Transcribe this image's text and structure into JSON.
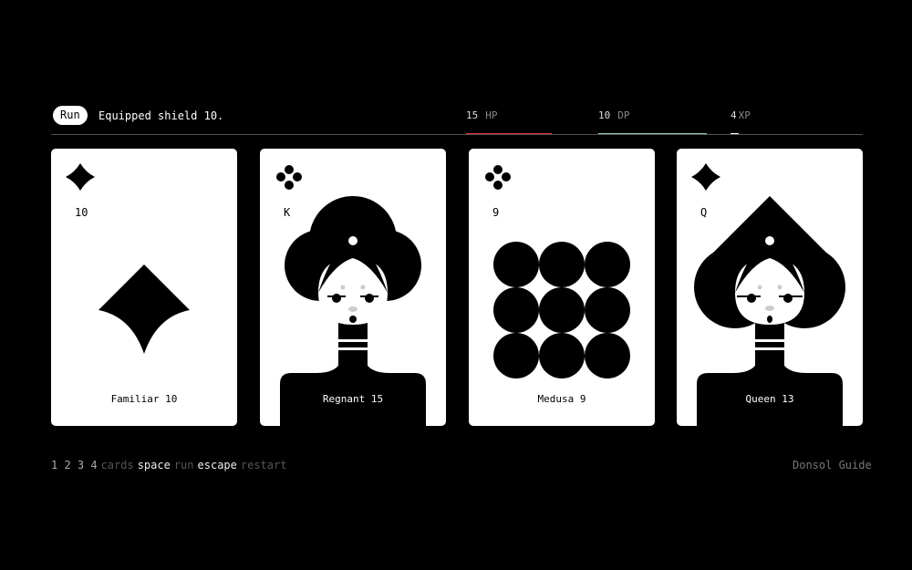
{
  "header": {
    "run_label": "Run",
    "message": "Equipped shield 10.",
    "stats": {
      "hp": {
        "value": "15",
        "label": "HP",
        "fraction": 0.65,
        "color": "#e3303a"
      },
      "dp": {
        "value": "10",
        "label": "DP",
        "fraction": 0.82,
        "color": "#8fd1b4"
      },
      "xp": {
        "value": "4",
        "label": "XP",
        "fraction": 0.06,
        "color": "#ffffff"
      }
    }
  },
  "cards": [
    {
      "suit": "diamond",
      "value": "10",
      "name": "Familiar 10",
      "art": "diamond-large"
    },
    {
      "suit": "club",
      "value": "K",
      "name": "Regnant 15",
      "art": "king-portrait"
    },
    {
      "suit": "club",
      "value": "9",
      "name": "Medusa 9",
      "art": "nine-circles"
    },
    {
      "suit": "diamond",
      "value": "Q",
      "name": "Queen 13",
      "art": "queen-portrait"
    }
  ],
  "footer": {
    "keys": "1 2 3 4",
    "keys_desc": "cards",
    "space": "space",
    "space_desc": "run",
    "escape": "escape",
    "escape_desc": "restart",
    "guide": "Donsol Guide"
  }
}
